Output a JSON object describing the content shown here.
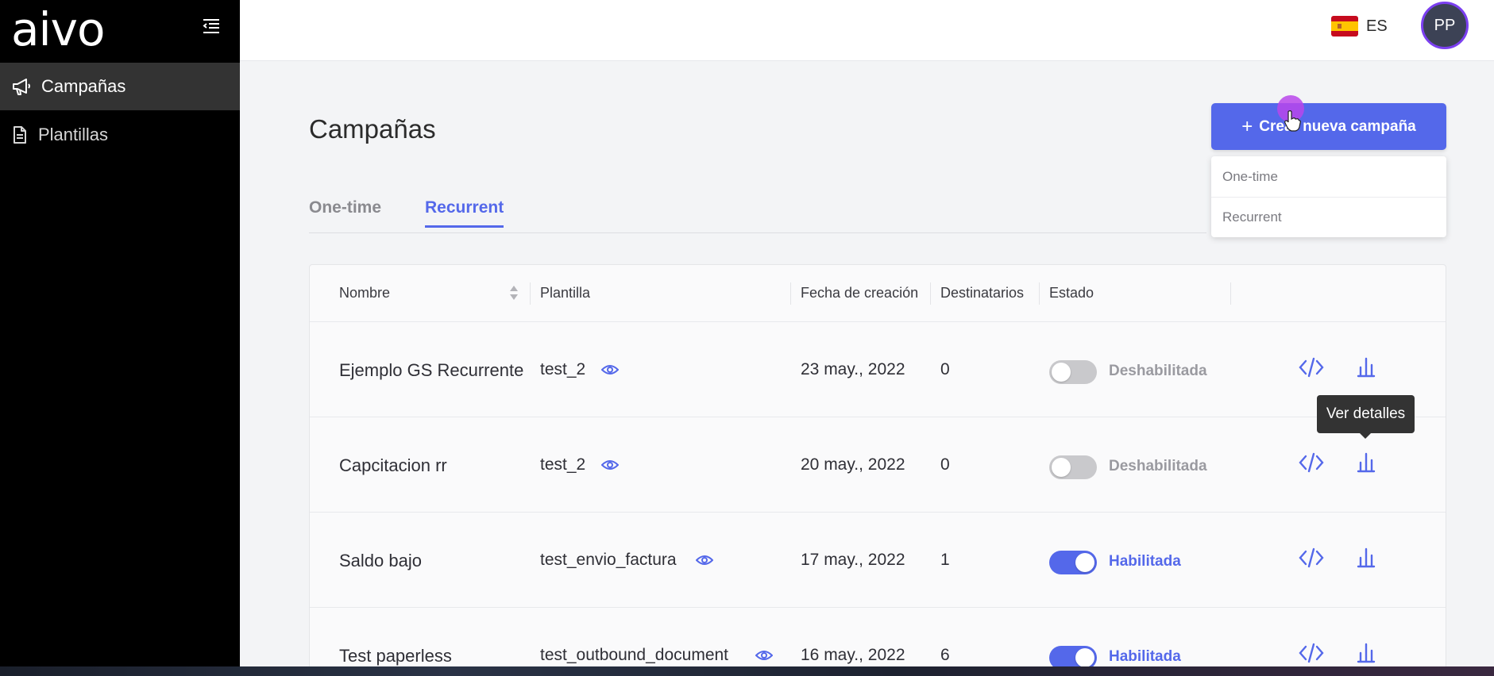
{
  "app": {
    "logo_text": "aivo"
  },
  "sidebar": {
    "items": [
      {
        "label": "Campañas",
        "icon": "megaphone-icon",
        "active": true
      },
      {
        "label": "Plantillas",
        "icon": "document-icon",
        "active": false
      }
    ]
  },
  "topbar": {
    "language": "ES",
    "flag": "spain-flag-icon",
    "avatar_initials": "PP"
  },
  "main": {
    "title": "Campañas",
    "tabs": [
      {
        "label": "One-time",
        "active": false
      },
      {
        "label": "Recurrent",
        "active": true
      }
    ],
    "create_button": {
      "label": "Crear nueva campaña",
      "icon": "plus-icon"
    },
    "create_menu": {
      "options": [
        "One-time",
        "Recurrent"
      ]
    },
    "table": {
      "headers": [
        "Nombre",
        "Plantilla",
        "Fecha de creación",
        "Destinatarios",
        "Estado"
      ],
      "rows": [
        {
          "name": "Ejemplo GS Recurrente",
          "template": "test_2",
          "date": "23 may., 2022",
          "recipients": "0",
          "enabled": false,
          "state": "Deshabilitada"
        },
        {
          "name": "Capcitacion rr",
          "template": "test_2",
          "date": "20 may., 2022",
          "recipients": "0",
          "enabled": false,
          "state": "Deshabilitada"
        },
        {
          "name": "Saldo bajo",
          "template": "test_envio_factura",
          "date": "17 may., 2022",
          "recipients": "1",
          "enabled": true,
          "state": "Habilitada"
        },
        {
          "name": "Test paperless",
          "template": "test_outbound_document",
          "date": "16 may., 2022",
          "recipients": "6",
          "enabled": true,
          "state": "Habilitada"
        }
      ]
    },
    "tooltip": "Ver detalles"
  },
  "colors": {
    "accent": "#5468ea",
    "sidebar_bg": "#000000",
    "active_nav": "#333333",
    "avatar_ring": "#7b3ff0"
  }
}
